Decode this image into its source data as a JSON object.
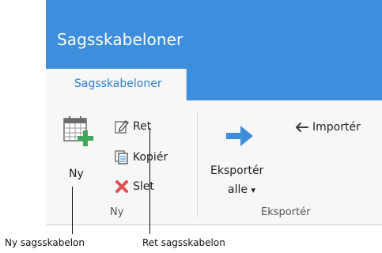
{
  "window": {
    "title": "Sagsskabeloner"
  },
  "tabs": [
    {
      "label": "Sagsskabeloner",
      "active": true
    }
  ],
  "ribbon": {
    "group_ny": {
      "label": "Ny",
      "new_button": {
        "label": "Ny",
        "icon": "calendar-add-icon"
      },
      "edit_button": {
        "label": "Ret",
        "icon": "edit-pencil-icon"
      },
      "copy_button": {
        "label": "Kopiér",
        "icon": "copy-icon"
      },
      "delete_button": {
        "label": "Slet",
        "icon": "delete-x-icon"
      }
    },
    "group_eksporter": {
      "label": "Eksportér",
      "export_all": {
        "line1": "Eksportér",
        "line2": "alle",
        "dropdown": "▾",
        "icon": "arrow-right-icon"
      },
      "import_button": {
        "label": "Importér",
        "icon": "arrow-left-icon"
      }
    }
  },
  "callouts": {
    "new_template": "Ny sagsskabelon",
    "edit_template": "Ret sagsskabelon"
  },
  "colors": {
    "accent": "#3d8fdd",
    "tab_text": "#2c7fd1",
    "ribbon_bg": "#f7f7f7",
    "add_green": "#3fa65a",
    "delete_red": "#d9534f"
  }
}
